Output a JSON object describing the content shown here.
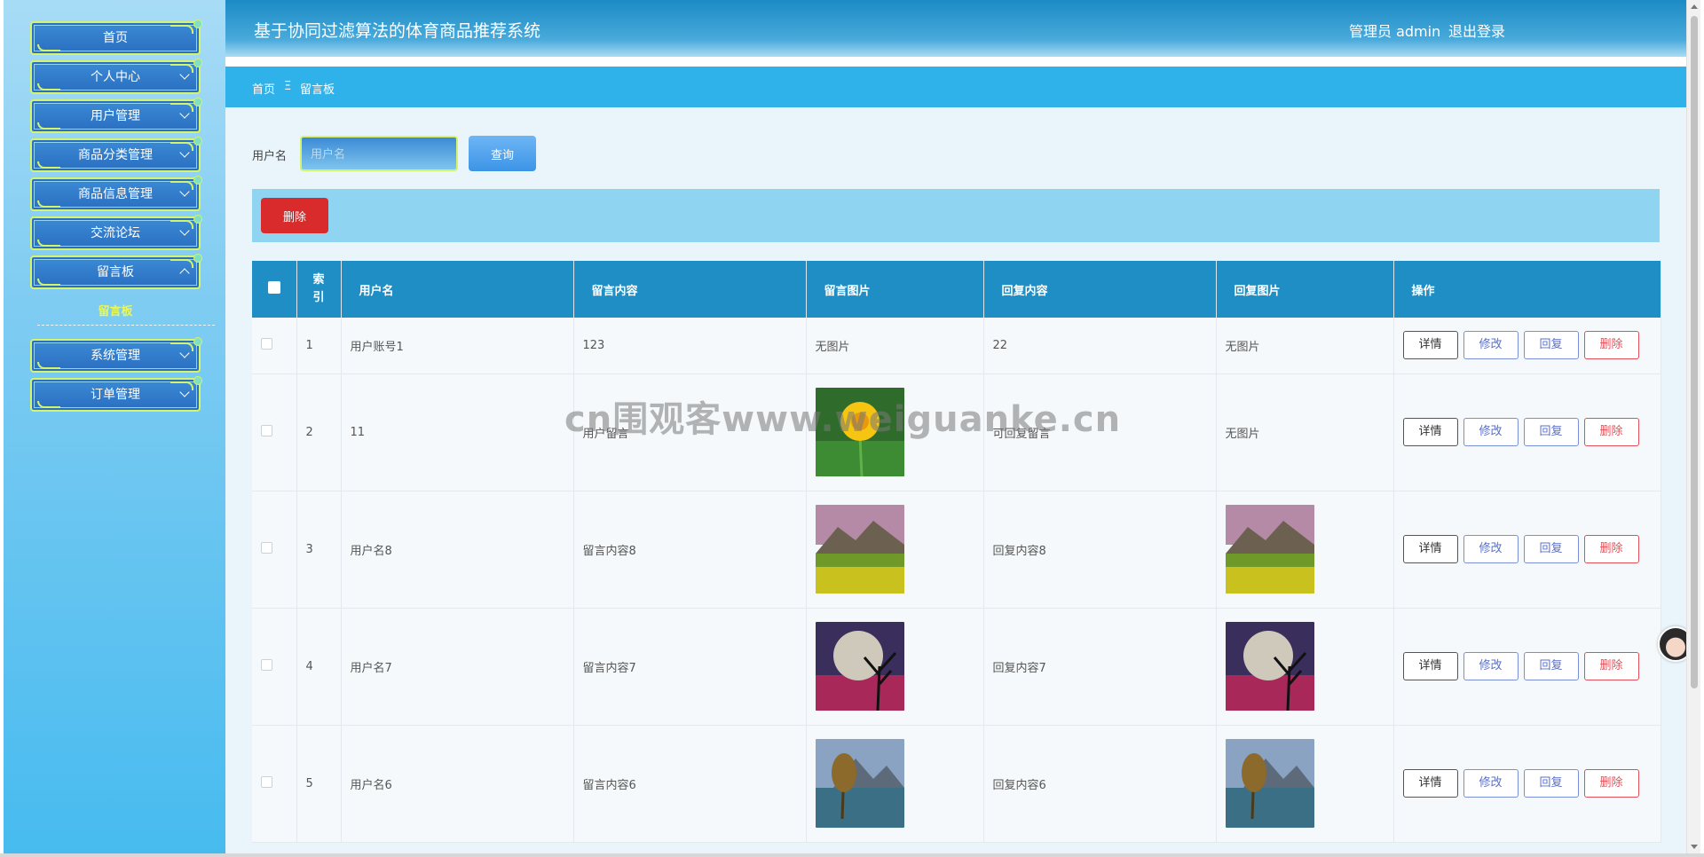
{
  "header": {
    "title": "基于协同过滤算法的体育商品推荐系统",
    "user": "管理员 admin",
    "logout": "退出登录"
  },
  "sidebar": {
    "items": [
      {
        "label": "首页"
      },
      {
        "label": "个人中心"
      },
      {
        "label": "用户管理"
      },
      {
        "label": "商品分类管理"
      },
      {
        "label": "商品信息管理"
      },
      {
        "label": "交流论坛"
      },
      {
        "label": "留言板"
      },
      {
        "label": "系统管理"
      },
      {
        "label": "订单管理"
      }
    ],
    "submenu": {
      "label": "留言板"
    }
  },
  "breadcrumb": {
    "home": "首页",
    "separator": "Ξ",
    "current": "留言板"
  },
  "search": {
    "label": "用户名",
    "placeholder": "用户名",
    "button": "查询"
  },
  "actions": {
    "delete": "删除"
  },
  "table": {
    "headers": {
      "index": "索引",
      "username": "用户名",
      "content": "留言内容",
      "image": "留言图片",
      "reply": "回复内容",
      "reply_image": "回复图片",
      "ops": "操作"
    },
    "ops": {
      "detail": "详情",
      "edit": "修改",
      "reply": "回复",
      "delete": "删除"
    },
    "rows": [
      {
        "index": "1",
        "username": "用户账号1",
        "content": "123",
        "image": "无图片",
        "reply": "22",
        "reply_image": "无图片"
      },
      {
        "index": "2",
        "username": "11",
        "content": "用户留言",
        "image": "flower",
        "reply": "可回复留言",
        "reply_image": "无图片"
      },
      {
        "index": "3",
        "username": "用户名8",
        "content": "留言内容8",
        "image": "meadow",
        "reply": "回复内容8",
        "reply_image": "meadow"
      },
      {
        "index": "4",
        "username": "用户名7",
        "content": "留言内容7",
        "image": "moon",
        "reply": "回复内容7",
        "reply_image": "moon"
      },
      {
        "index": "5",
        "username": "用户名6",
        "content": "留言内容6",
        "image": "lake",
        "reply": "回复内容6",
        "reply_image": "lake"
      }
    ]
  },
  "watermark": "cn围观客www.weiguanke.cn"
}
